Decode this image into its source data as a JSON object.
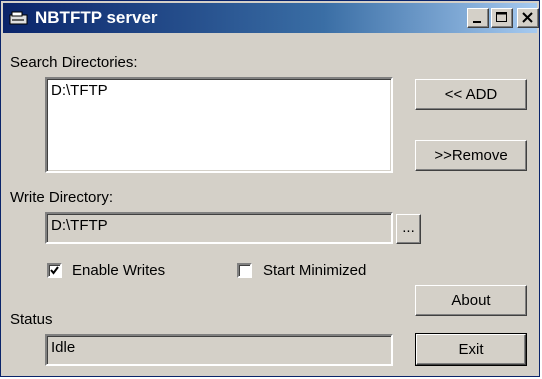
{
  "window": {
    "title": "NBTFTP server"
  },
  "search": {
    "label": "Search Directories:",
    "items": [
      "D:\\TFTP"
    ],
    "add_label": "<< ADD",
    "remove_label": ">>Remove"
  },
  "write": {
    "label": "Write Directory:",
    "value": "D:\\TFTP",
    "browse_label": "..."
  },
  "options": {
    "enable_writes_label": "Enable Writes",
    "enable_writes_checked": true,
    "start_minimized_label": "Start Minimized",
    "start_minimized_checked": false
  },
  "status": {
    "label": "Status",
    "value": "Idle"
  },
  "buttons": {
    "about_label": "About",
    "exit_label": "Exit"
  },
  "colors": {
    "titlebar_start": "#0a246a",
    "titlebar_end": "#a6caf0",
    "face": "#d4d0c8"
  }
}
